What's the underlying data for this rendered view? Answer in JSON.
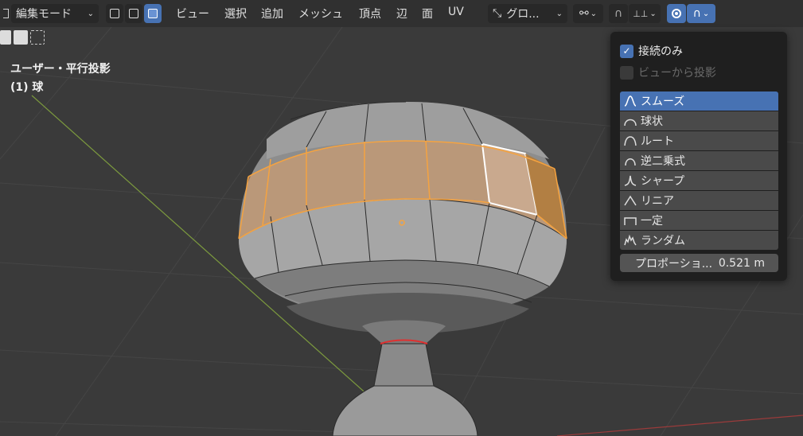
{
  "header": {
    "mode_label": "編集モード",
    "menus": [
      "ビュー",
      "選択",
      "追加",
      "メッシュ",
      "頂点",
      "辺",
      "面",
      "UV"
    ],
    "orientation_label": "グロ..."
  },
  "overlay": {
    "view_label": "ユーザー・平行投影",
    "object_label": "(1) 球"
  },
  "popover": {
    "connected_only_label": "接続のみ",
    "connected_only_checked": true,
    "projected_label": "ビューから投影",
    "projected_checked": false,
    "falloff_options": [
      {
        "label": "スムーズ",
        "icon": "smooth-falloff-icon",
        "selected": true
      },
      {
        "label": "球状",
        "icon": "sphere-falloff-icon",
        "selected": false
      },
      {
        "label": "ルート",
        "icon": "root-falloff-icon",
        "selected": false
      },
      {
        "label": "逆二乗式",
        "icon": "inverse-square-falloff-icon",
        "selected": false
      },
      {
        "label": "シャープ",
        "icon": "sharp-falloff-icon",
        "selected": false
      },
      {
        "label": "リニア",
        "icon": "linear-falloff-icon",
        "selected": false
      },
      {
        "label": "一定",
        "icon": "constant-falloff-icon",
        "selected": false
      },
      {
        "label": "ランダム",
        "icon": "random-falloff-icon",
        "selected": false
      }
    ],
    "proportional_size_label": "プロポーショ...",
    "proportional_size_value": "0.521 m"
  },
  "colors": {
    "accent": "#4772b3",
    "selection": "#f5a340",
    "active_face": "#ffffff",
    "seam": "#e03030"
  }
}
